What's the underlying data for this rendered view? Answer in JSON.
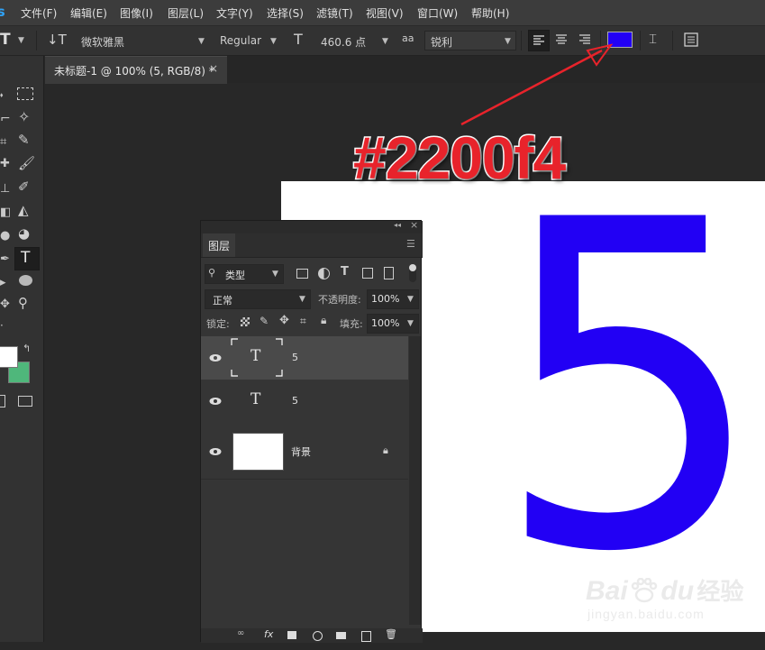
{
  "colors": {
    "accent_text_color": "#2200f4",
    "annotation_red": "#e8232b",
    "canvas_bg": "#ffffff"
  },
  "menubar": {
    "app_icon": "Ps",
    "items": [
      "文件(F)",
      "编辑(E)",
      "图像(I)",
      "图层(L)",
      "文字(Y)",
      "选择(S)",
      "滤镜(T)",
      "视图(V)",
      "窗口(W)",
      "帮助(H)"
    ]
  },
  "options": {
    "font_family": "微软雅黑",
    "font_style": "Regular",
    "font_size": "460.6 点",
    "antialias_label": "aa",
    "antialias": "锐利",
    "color_swatch": "#2200f4"
  },
  "document": {
    "tab_title": "未标题-1 @ 100% (5, RGB/8) *",
    "canvas_text": "5"
  },
  "layers_panel": {
    "tab_label": "图层",
    "filter_kind": "类型",
    "blend_mode": "正常",
    "opacity_label": "不透明度:",
    "opacity_value": "100%",
    "lock_label": "锁定:",
    "fill_label": "填充:",
    "fill_value": "100%",
    "layers": [
      {
        "name": "5",
        "type": "text",
        "selected": true
      },
      {
        "name": "5",
        "type": "text",
        "selected": false
      },
      {
        "name": "背景",
        "type": "background",
        "locked": true
      }
    ],
    "footer_fx": "fx"
  },
  "annotation": {
    "text": "#2200f4"
  },
  "watermark": {
    "brand": "Bai",
    "brand_tail": "du",
    "product": "经验",
    "url": "jingyan.baidu.com"
  }
}
